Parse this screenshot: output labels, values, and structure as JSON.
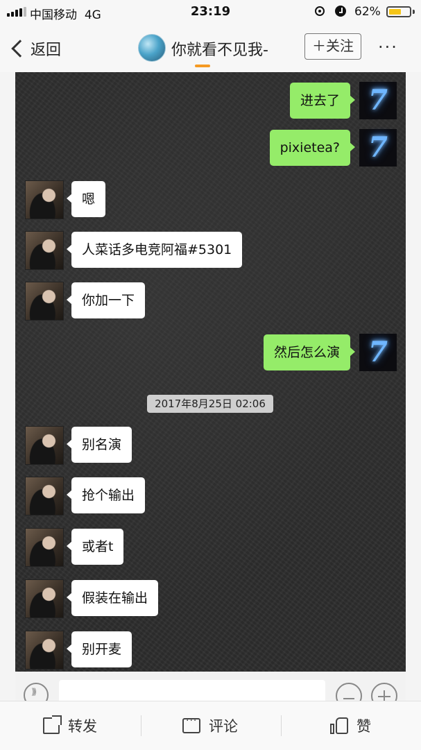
{
  "status_bar": {
    "carrier": "中国移动",
    "network": "4G",
    "time": "23:19",
    "battery_percent": "62%",
    "battery_level": 0.62,
    "icons": [
      "signal-icon",
      "orientation-lock-icon",
      "alarm-icon",
      "battery-icon"
    ]
  },
  "header": {
    "back_label": "返回",
    "title": "你就看不见我-",
    "follow_label": "＋关注",
    "more_label": "···",
    "accent_color": "#f59a23"
  },
  "chat": {
    "messages": [
      {
        "side": "right",
        "text": "进去了"
      },
      {
        "side": "right",
        "text": "pixietea?"
      },
      {
        "side": "left",
        "text": "嗯"
      },
      {
        "side": "left",
        "text": "人菜话多电竞阿福#5301"
      },
      {
        "side": "left",
        "text": "你加一下"
      },
      {
        "side": "right",
        "text": "然后怎么演"
      },
      {
        "side": "left",
        "text": "别名演"
      },
      {
        "side": "left",
        "text": "抢个输出"
      },
      {
        "side": "left",
        "text": "或者t"
      },
      {
        "side": "left",
        "text": "假装在输出"
      },
      {
        "side": "left",
        "text": "别开麦"
      }
    ],
    "timestamp": "2017年8月25日 02:06",
    "right_avatar_glyph": "7",
    "bubble_colors": {
      "sent": "#95ec69",
      "received": "#ffffff"
    }
  },
  "actions": {
    "share_label": "转发",
    "comment_label": "评论",
    "like_label": "赞"
  }
}
